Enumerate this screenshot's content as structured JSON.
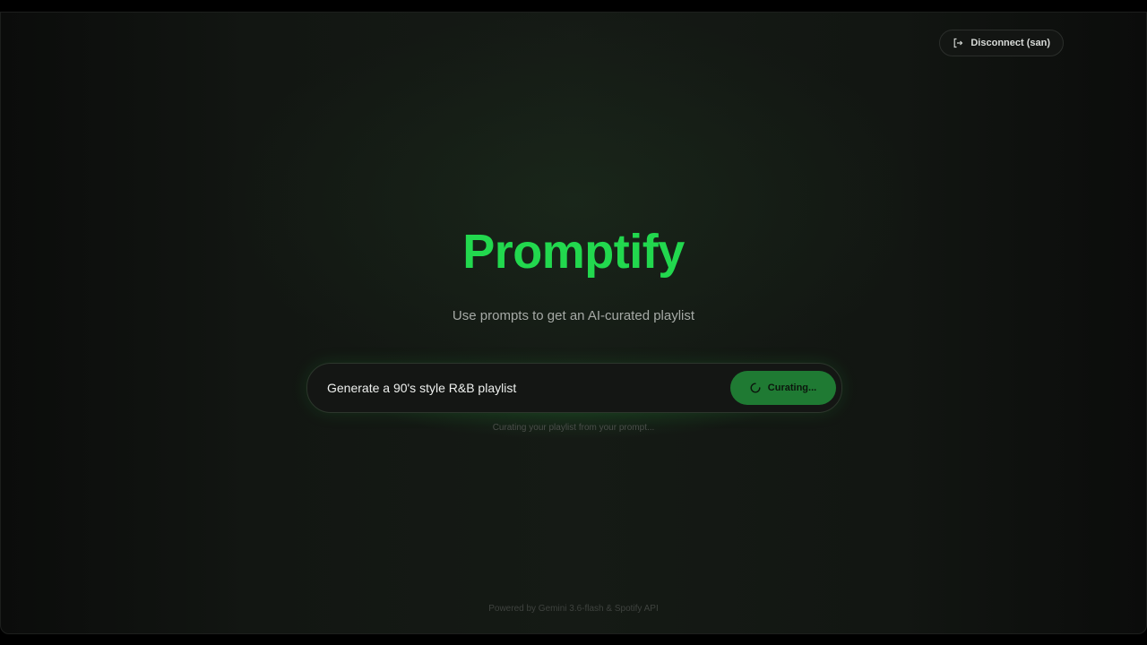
{
  "header": {
    "disconnect_label": "Disconnect (san)",
    "disconnect_icon": "logout-icon"
  },
  "hero": {
    "title": "Promptify",
    "subtitle": "Use prompts to get an AI-curated playlist"
  },
  "prompt": {
    "value": "Generate a 90's style R&B playlist",
    "button_label": "Curating...",
    "button_icon": "spinner-icon",
    "status_text": "Curating your playlist from your prompt..."
  },
  "footer": {
    "text": "Powered by Gemini 3.6-flash & Spotify API"
  },
  "colors": {
    "accent": "#22d84e",
    "button": "#1f7a33",
    "background": "#141814"
  }
}
